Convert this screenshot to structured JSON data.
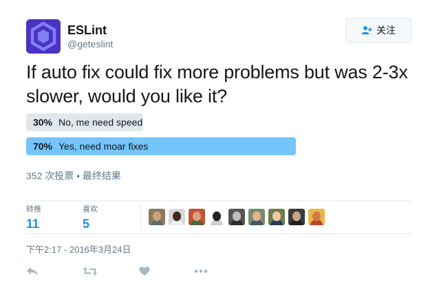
{
  "account": {
    "name": "ESLint",
    "handle": "@geteslint",
    "follow_label": "关注"
  },
  "tweet": {
    "text": "If auto fix could fix more problems but was 2-3x slower, would you like it?"
  },
  "poll": {
    "options": [
      {
        "percent_label": "30%",
        "label": "No, me need speed",
        "share": 0.3,
        "winner": false
      },
      {
        "percent_label": "70%",
        "label": "Yes, need moar fixes",
        "share": 0.7,
        "winner": true
      }
    ],
    "meta": "352 次投票 • 最终结果"
  },
  "stats": {
    "retweets_label": "转推",
    "retweets_count": "11",
    "likes_label": "喜欢",
    "likes_count": "5"
  },
  "likers": [
    {
      "colors": [
        "#8d7a5e",
        "#c9a27c",
        "#5b6b7a"
      ]
    },
    {
      "colors": [
        "#d9d9d9",
        "#3a2a22",
        "#f0f0f0"
      ]
    },
    {
      "colors": [
        "#c0533a",
        "#e0a07a",
        "#4a6a3a"
      ]
    },
    {
      "colors": [
        "#ffffff",
        "#222222",
        "#cfcfcf"
      ]
    },
    {
      "colors": [
        "#555555",
        "#bdbdbd",
        "#2e2e2e"
      ]
    },
    {
      "colors": [
        "#7a8a6a",
        "#e2b48e",
        "#44566a"
      ]
    },
    {
      "colors": [
        "#6d7c4f",
        "#f0c9a2",
        "#2a3b5a"
      ]
    },
    {
      "colors": [
        "#3b3b3b",
        "#caa58a",
        "#1f1f1f"
      ]
    },
    {
      "colors": [
        "#e8b94a",
        "#d4794a",
        "#b8452a"
      ]
    }
  ],
  "timestamp": "下午2:17 - 2016年3月24日",
  "colors": {
    "brand": "#4b32c3",
    "link": "#1b95e0",
    "poll_winner": "#75c5fb",
    "poll_loser": "#e1e8ed",
    "muted": "#657786"
  },
  "icons": {
    "reply": "reply-icon",
    "retweet": "retweet-icon",
    "like": "heart-icon",
    "more": "more-icon",
    "follow": "add-user-icon"
  }
}
